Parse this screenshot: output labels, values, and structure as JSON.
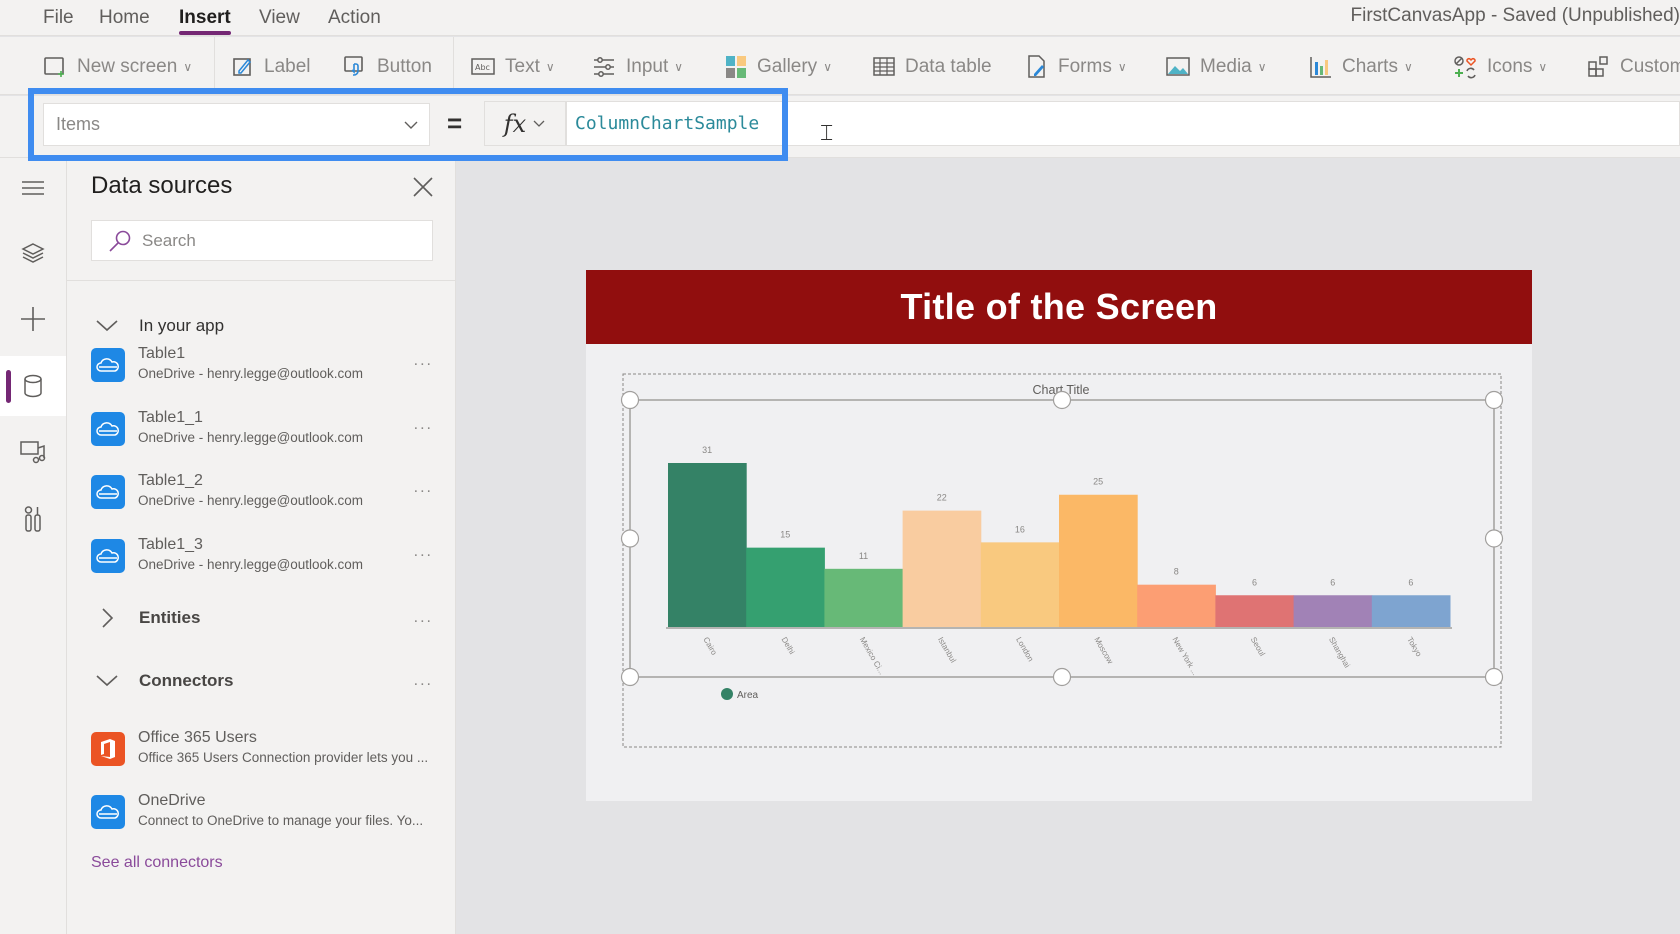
{
  "menu": {
    "items": [
      "File",
      "Home",
      "Insert",
      "View",
      "Action"
    ],
    "active": "Insert"
  },
  "app_title": "FirstCanvasApp - Saved (Unpublished)",
  "toolbar": {
    "new_screen": "New screen",
    "label": "Label",
    "button": "Button",
    "text": "Text",
    "input": "Input",
    "gallery": "Gallery",
    "data_table": "Data table",
    "forms": "Forms",
    "media": "Media",
    "charts": "Charts",
    "icons": "Icons",
    "custom": "Custom"
  },
  "formula_bar": {
    "property": "Items",
    "equals": "=",
    "fx_label": "fx",
    "formula": "ColumnChartSample"
  },
  "left_rail": {
    "items": [
      "menu",
      "tree-view",
      "insert",
      "data",
      "media",
      "advanced-tools"
    ],
    "active": "data"
  },
  "panel": {
    "title": "Data sources",
    "search_placeholder": "Search",
    "sections": {
      "in_your_app": "In your app",
      "entities": "Entities",
      "connectors": "Connectors"
    },
    "in_app_items": [
      {
        "name": "Table1",
        "sub": "OneDrive - henry.legge@outlook.com"
      },
      {
        "name": "Table1_1",
        "sub": "OneDrive - henry.legge@outlook.com"
      },
      {
        "name": "Table1_2",
        "sub": "OneDrive - henry.legge@outlook.com"
      },
      {
        "name": "Table1_3",
        "sub": "OneDrive - henry.legge@outlook.com"
      }
    ],
    "connector_items": [
      {
        "name": "Office 365 Users",
        "sub": "Office 365 Users Connection provider lets you ..."
      },
      {
        "name": "OneDrive",
        "sub": "Connect to OneDrive to manage your files. Yo..."
      }
    ],
    "see_all": "See all connectors",
    "more": "..."
  },
  "screen": {
    "title": "Title of the Screen",
    "header_color": "#910e0e"
  },
  "colors": {
    "accent": "#742774",
    "highlight": "#3f8cf0",
    "onedrive": "#1e88e5",
    "office": "#eb5424"
  },
  "chart_data": {
    "type": "bar",
    "title": "Chart Title",
    "categories": [
      "Cairo",
      "Delhi",
      "Mexico Ci...",
      "Istanbul",
      "London",
      "Moscow",
      "New York ...",
      "Seoul",
      "Shanghai",
      "Tokyo"
    ],
    "series": [
      {
        "name": "Area",
        "values": [
          31,
          15,
          11,
          22,
          16,
          25,
          8,
          6,
          6,
          6
        ]
      }
    ],
    "bar_colors": [
      "#348266",
      "#35a070",
      "#67b977",
      "#f9cca0",
      "#f9c97f",
      "#fbb866",
      "#fc9e73",
      "#df7373",
      "#a182b6",
      "#7ea4d0"
    ],
    "legend": [
      "Area"
    ],
    "legend_position": "bottom-left",
    "xlabel": "",
    "ylabel": "",
    "ylim": [
      0,
      31
    ],
    "grid": false,
    "data_labels": true
  }
}
